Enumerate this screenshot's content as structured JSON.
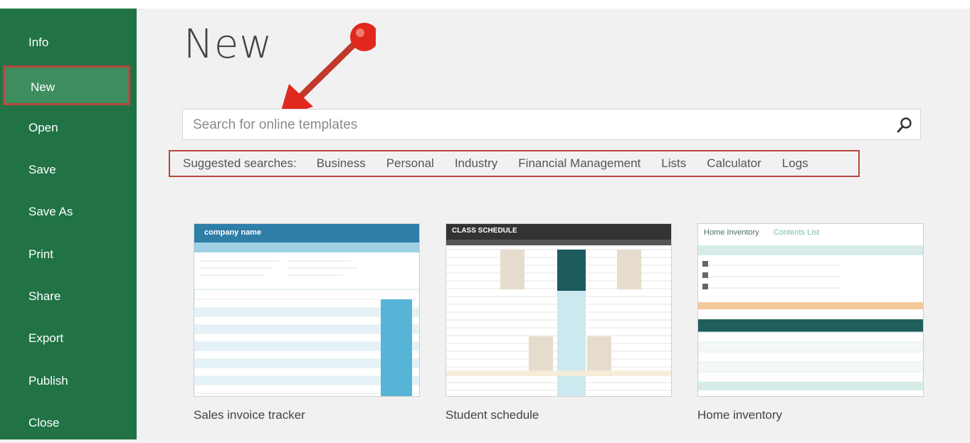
{
  "sidebar": {
    "items": [
      {
        "label": "Info"
      },
      {
        "label": "New",
        "active": true
      },
      {
        "label": "Open"
      },
      {
        "label": "Save"
      },
      {
        "label": "Save As"
      },
      {
        "label": "Print"
      },
      {
        "label": "Share"
      },
      {
        "label": "Export"
      },
      {
        "label": "Publish"
      },
      {
        "label": "Close"
      }
    ],
    "background": "#217346",
    "active_background": "#3f8e5f",
    "highlight_border": "#b8473f"
  },
  "main": {
    "title": "New",
    "search": {
      "placeholder": "Search for online templates",
      "icon": "search-icon"
    },
    "suggested": {
      "label": "Suggested searches:",
      "items": [
        "Business",
        "Personal",
        "Industry",
        "Financial Management",
        "Lists",
        "Calculator",
        "Logs"
      ]
    },
    "templates": [
      {
        "name": "Sales invoice tracker",
        "header": "company name"
      },
      {
        "name": "Student schedule",
        "header": "CLASS SCHEDULE"
      },
      {
        "name": "Home inventory",
        "header": "Home Inventory",
        "subheader": "Contents List"
      }
    ],
    "annotation": "red-arrow-pointer"
  }
}
